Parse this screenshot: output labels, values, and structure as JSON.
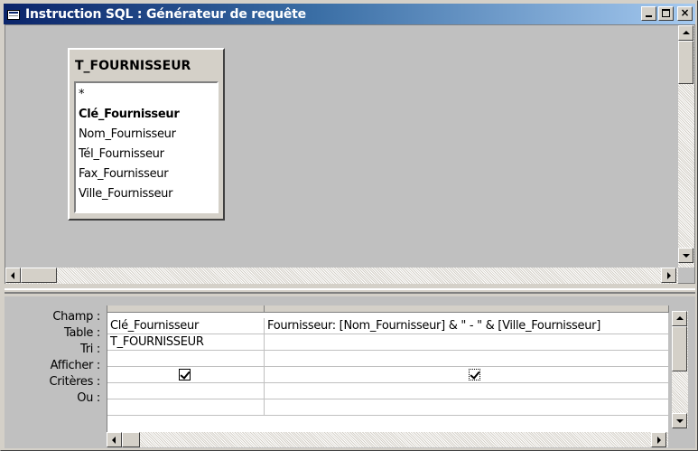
{
  "window": {
    "title": "Instruction SQL : Générateur de requête",
    "minimize_label": "_",
    "close_label": "×"
  },
  "table_box": {
    "name": "T_FOURNISSEUR",
    "fields": [
      {
        "label": "*",
        "bold": false
      },
      {
        "label": "Clé_Fournisseur",
        "bold": true
      },
      {
        "label": "Nom_Fournisseur",
        "bold": false
      },
      {
        "label": "Tél_Fournisseur",
        "bold": false
      },
      {
        "label": "Fax_Fournisseur",
        "bold": false
      },
      {
        "label": "Ville_Fournisseur",
        "bold": false
      }
    ]
  },
  "grid": {
    "row_labels": [
      "Champ :",
      "Table :",
      "Tri :",
      "Afficher :",
      "Critères :",
      "Ou :"
    ],
    "columns": [
      {
        "champ": "Clé_Fournisseur",
        "table": "T_FOURNISSEUR",
        "tri": "",
        "afficher": true,
        "criteres": "",
        "ou": ""
      },
      {
        "champ": "Fournisseur: [Nom_Fournisseur] & \" - \" & [Ville_Fournisseur]",
        "table": "",
        "tri": "",
        "afficher": true,
        "criteres": "",
        "ou": ""
      }
    ]
  },
  "icons": {
    "window_icon": "query-builder-icon",
    "checkbox": "checkbox-checked-icon"
  }
}
